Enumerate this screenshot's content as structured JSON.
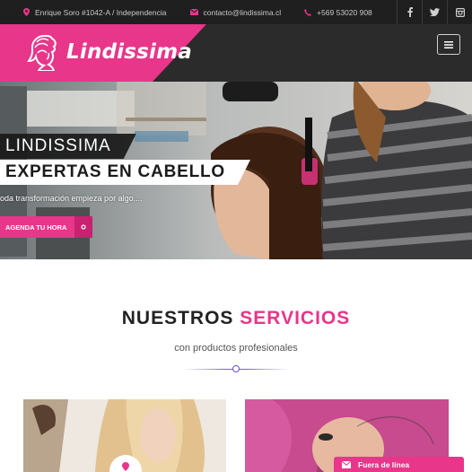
{
  "topbar": {
    "address": "Enrique Soro #1042-A / Independencia",
    "email": "contacto@lindissima.cl",
    "phone": "+569 53020 908",
    "address_icon": "map-pin-icon",
    "email_icon": "envelope-icon",
    "phone_icon": "phone-icon",
    "socials": [
      "facebook-icon",
      "twitter-icon",
      "instagram-icon"
    ]
  },
  "header": {
    "logo_text": "Lindissima",
    "menu_icon": "hamburger-icon",
    "colors": {
      "brand_pink": "#e8368a",
      "header_dark": "#2b2b2b"
    }
  },
  "hero": {
    "tag_line_1": "LINDISSIMA",
    "tag_line_2": "EXPERTAS EN CABELLO",
    "subtitle": "oda transformación empieza por algo....",
    "cta_label": "AGENDA TU HORA",
    "cta_icon": "chevron-right-icon"
  },
  "services": {
    "title_part_1": "NUESTROS",
    "title_part_2": "SERVICIOS",
    "subtitle": "con productos profesionales"
  },
  "chat": {
    "label": "Fuera de línea",
    "icon": "envelope-icon"
  }
}
